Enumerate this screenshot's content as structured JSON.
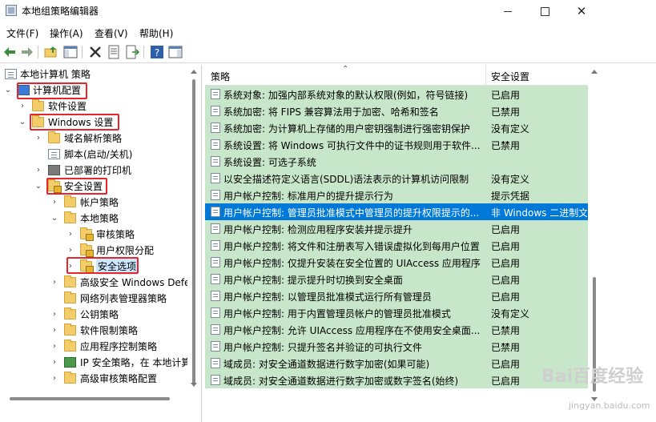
{
  "window": {
    "title": "本地组策略编辑器",
    "minimize_label": "—",
    "maximize_label": "□",
    "close_label": "✕"
  },
  "menu": [
    {
      "label": "文件(F)"
    },
    {
      "label": "操作(A)"
    },
    {
      "label": "查看(V)"
    },
    {
      "label": "帮助(H)"
    }
  ],
  "toolbar": {
    "icons": [
      "back-arrow-icon",
      "forward-arrow-icon",
      "up-folder-icon",
      "show-hide-tree-icon",
      "delete-icon",
      "properties-icon",
      "export-list-icon",
      "help-icon",
      "show-hide-action-pane-icon"
    ]
  },
  "tree": {
    "items": [
      {
        "label": "本地计算机 策略",
        "expanded": true,
        "icon": "computer-doc-icon",
        "highlighted": false
      },
      {
        "label": "计算机配置",
        "expanded": true,
        "icon": "computer-icon",
        "highlighted": true
      },
      {
        "label": "软件设置",
        "expanded": false,
        "icon": "folder-icon",
        "highlighted": false
      },
      {
        "label": "Windows 设置",
        "expanded": true,
        "icon": "folder-icon",
        "highlighted": true
      },
      {
        "label": "域名解析策略",
        "expanded": false,
        "icon": "folder-icon",
        "highlighted": false
      },
      {
        "label": "脚本(启动/关机)",
        "expanded": false,
        "icon": "script-icon",
        "highlighted": false
      },
      {
        "label": "已部署的打印机",
        "expanded": false,
        "icon": "printer-icon",
        "highlighted": false
      },
      {
        "label": "安全设置",
        "expanded": true,
        "icon": "lock-folder-icon",
        "highlighted": true
      },
      {
        "label": "帐户策略",
        "expanded": false,
        "icon": "folder-icon",
        "highlighted": false
      },
      {
        "label": "本地策略",
        "expanded": true,
        "icon": "folder-icon",
        "highlighted": false
      },
      {
        "label": "审核策略",
        "expanded": false,
        "icon": "lock-folder-icon",
        "highlighted": false
      },
      {
        "label": "用户权限分配",
        "expanded": false,
        "icon": "lock-folder-icon",
        "highlighted": false
      },
      {
        "label": "安全选项",
        "expanded": false,
        "icon": "lock-folder-icon",
        "highlighted": true,
        "selected": true
      },
      {
        "label": "高级安全 Windows Defe",
        "expanded": false,
        "icon": "folder-icon",
        "highlighted": false
      },
      {
        "label": "网络列表管理器策略",
        "expanded": false,
        "icon": "folder-icon",
        "highlighted": false
      },
      {
        "label": "公钥策略",
        "expanded": false,
        "icon": "folder-icon",
        "highlighted": false
      },
      {
        "label": "软件限制策略",
        "expanded": false,
        "icon": "folder-icon",
        "highlighted": false
      },
      {
        "label": "应用程序控制策略",
        "expanded": false,
        "icon": "folder-icon",
        "highlighted": false
      },
      {
        "label": "IP 安全策略，在 本地计算",
        "expanded": false,
        "icon": "ip-security-icon",
        "highlighted": false
      },
      {
        "label": "高级审核策略配置",
        "expanded": false,
        "icon": "folder-icon",
        "highlighted": false
      }
    ]
  },
  "table": {
    "columns": [
      "策略",
      "安全设置"
    ],
    "rows": [
      {
        "policy": "系统对象: 加强内部系统对象的默认权限(例如，符号链接)",
        "setting": "已启用",
        "selected": false
      },
      {
        "policy": "系统加密: 将 FIPS 兼容算法用于加密、哈希和签名",
        "setting": "已禁用",
        "selected": false
      },
      {
        "policy": "系统加密: 为计算机上存储的用户密钥强制进行强密钥保护",
        "setting": "没有定义",
        "selected": false
      },
      {
        "policy": "系统设置: 将 Windows 可执行文件中的证书规则用于软件...",
        "setting": "已禁用",
        "selected": false
      },
      {
        "policy": "系统设置: 可选子系统",
        "setting": "",
        "selected": false
      },
      {
        "policy": "以安全描述符定义语言(SDDL)语法表示的计算机访问限制",
        "setting": "没有定义",
        "selected": false
      },
      {
        "policy": "用户帐户控制: 标准用户的提升提示行为",
        "setting": "提示凭据",
        "selected": false
      },
      {
        "policy": "用户帐户控制: 管理员批准模式中管理员的提升权限提示的...",
        "setting": "非 Windows 二进制文",
        "selected": true
      },
      {
        "policy": "用户帐户控制: 检测应用程序安装并提示提升",
        "setting": "已启用",
        "selected": false
      },
      {
        "policy": "用户帐户控制: 将文件和注册表写入错误虚拟化到每用户位置",
        "setting": "已启用",
        "selected": false
      },
      {
        "policy": "用户帐户控制: 仅提升安装在安全位置的 UIAccess 应用程序",
        "setting": "已启用",
        "selected": false
      },
      {
        "policy": "用户帐户控制: 提示提升时切换到安全桌面",
        "setting": "已启用",
        "selected": false
      },
      {
        "policy": "用户帐户控制: 以管理员批准模式运行所有管理员",
        "setting": "已启用",
        "selected": false
      },
      {
        "policy": "用户帐户控制: 用于内置管理员帐户的管理员批准模式",
        "setting": "没有定义",
        "selected": false
      },
      {
        "policy": "用户帐户控制: 允许 UIAccess 应用程序在不使用安全桌面...",
        "setting": "已禁用",
        "selected": false
      },
      {
        "policy": "用户帐户控制: 只提升签名并验证的可执行文件",
        "setting": "已禁用",
        "selected": false
      },
      {
        "policy": "域成员: 对安全通道数据进行数字加密(如果可能)",
        "setting": "已启用",
        "selected": false
      },
      {
        "policy": "域成员: 对安全通道数据进行数字加密或数字签名(始终)",
        "setting": "已启用",
        "selected": false
      }
    ]
  },
  "watermark": {
    "logo": "Bai百度经验",
    "url": "jingyan.baidu.com"
  },
  "colors": {
    "row_background": "#c8e6c9",
    "selected_row": "#0078d7",
    "highlight_box": "#e8252a"
  }
}
